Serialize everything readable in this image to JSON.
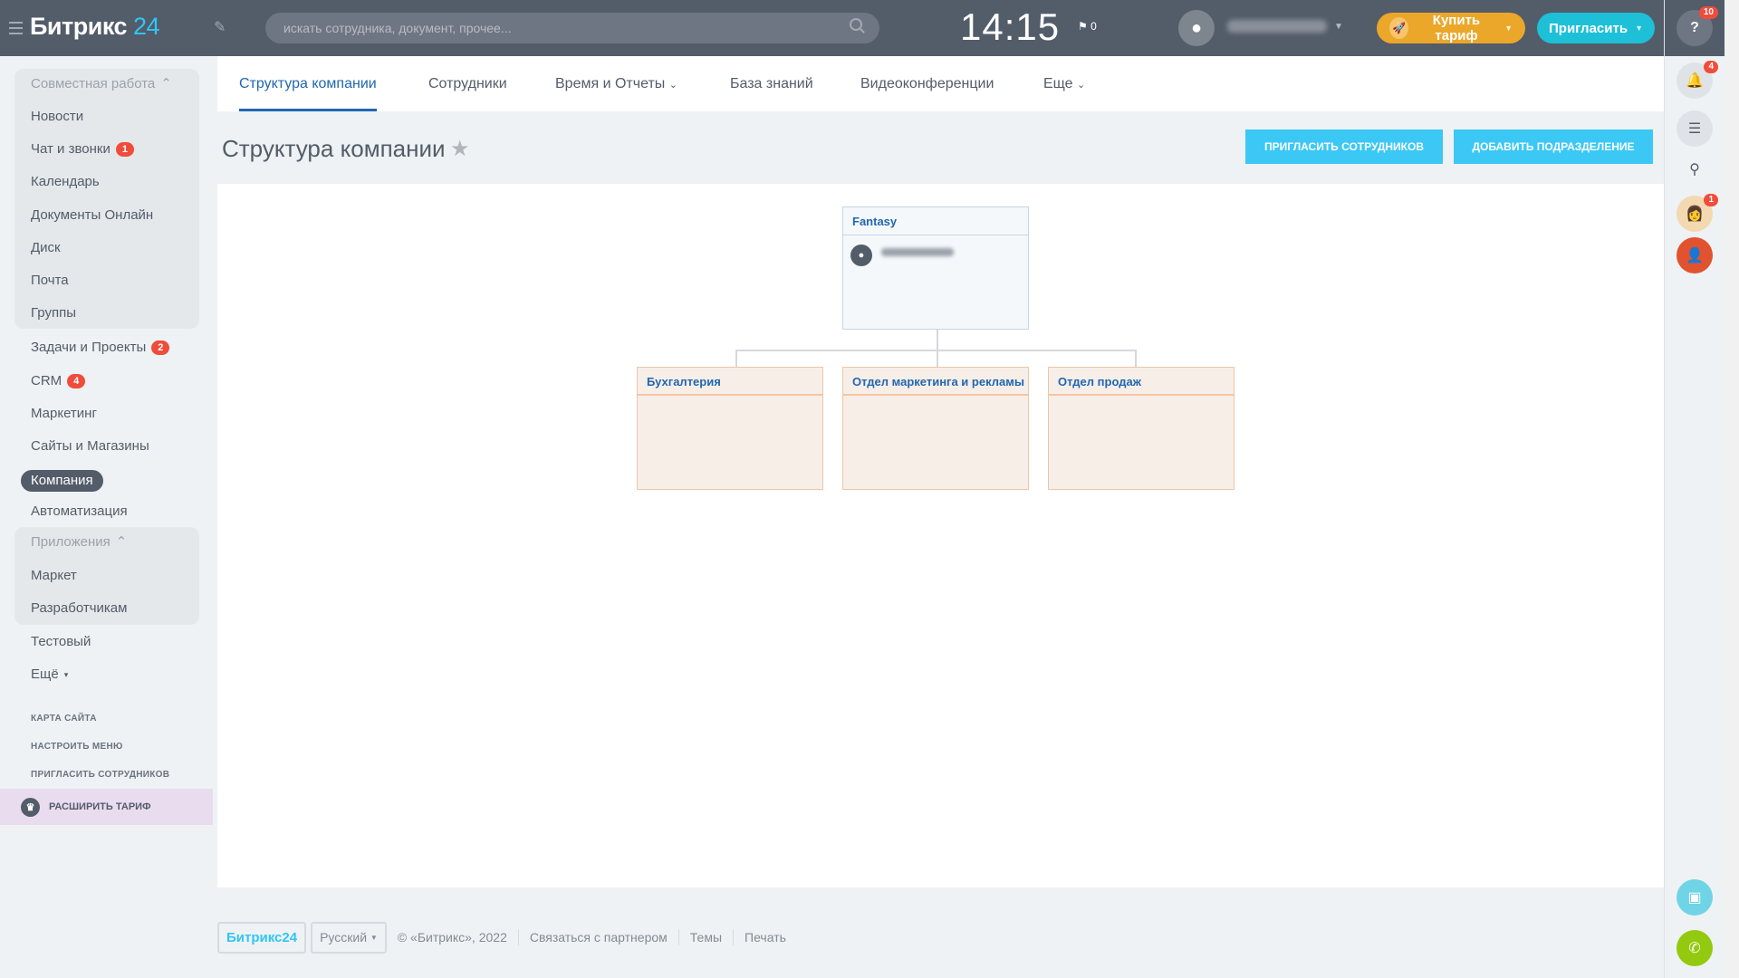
{
  "header": {
    "logo_text": "Битрикс",
    "logo_num": "24",
    "search_placeholder": "искать сотрудника, документ, прочее...",
    "clock": "14:15",
    "flag_count": "0",
    "buy_label": "Купить тариф",
    "invite_label": "Пригласить",
    "help_badge": "10"
  },
  "right_panel": {
    "notifications_badge": "4",
    "chat_badge": "1"
  },
  "sidebar": {
    "group1_title": "Совместная работа",
    "items": [
      {
        "label": "Новости"
      },
      {
        "label": "Чат и звонки",
        "count": "1"
      },
      {
        "label": "Календарь"
      },
      {
        "label": "Документы Онлайн"
      },
      {
        "label": "Диск"
      },
      {
        "label": "Почта"
      },
      {
        "label": "Группы"
      },
      {
        "label": "Задачи и Проекты",
        "count": "2"
      },
      {
        "label": "CRM",
        "count": "4"
      },
      {
        "label": "Маркетинг"
      },
      {
        "label": "Сайты и Магазины"
      },
      {
        "label": "Компания",
        "active": true
      },
      {
        "label": "Автоматизация"
      }
    ],
    "group2_title": "Приложения",
    "apps": [
      {
        "label": "Маркет"
      },
      {
        "label": "Разработчикам"
      }
    ],
    "extra": [
      {
        "label": "Тестовый"
      },
      {
        "label": "Ещё"
      }
    ],
    "links": [
      "КАРТА САЙТА",
      "НАСТРОИТЬ МЕНЮ",
      "ПРИГЛАСИТЬ СОТРУДНИКОВ"
    ],
    "upgrade_label": "РАСШИРИТЬ ТАРИФ"
  },
  "tabs": [
    {
      "label": "Структура компании",
      "active": true
    },
    {
      "label": "Сотрудники"
    },
    {
      "label": "Время и Отчеты",
      "dropdown": true
    },
    {
      "label": "База знаний"
    },
    {
      "label": "Видеоконференции"
    },
    {
      "label": "Еще",
      "dropdown": true
    }
  ],
  "page": {
    "title": "Структура компании",
    "invite_button": "ПРИГЛАСИТЬ СОТРУДНИКОВ",
    "add_dept_button": "ДОБАВИТЬ ПОДРАЗДЕЛЕНИЕ"
  },
  "structure": {
    "root": {
      "name": "Fantasy"
    },
    "departments": [
      {
        "name": "Бухгалтерия"
      },
      {
        "name": "Отдел маркетинга и рекламы"
      },
      {
        "name": "Отдел продаж"
      }
    ]
  },
  "footer": {
    "logo": "Битрикс24",
    "language": "Русский",
    "copyright": "© «Битрикс», 2022",
    "links": [
      "Связаться с партнером",
      "Темы",
      "Печать"
    ]
  },
  "colors": {
    "header": "#535c69",
    "accent": "#2067b0",
    "buy": "#eba72a",
    "invite": "#1ec0d8",
    "action": "#3bc8f5",
    "badge": "#f04c3b"
  }
}
